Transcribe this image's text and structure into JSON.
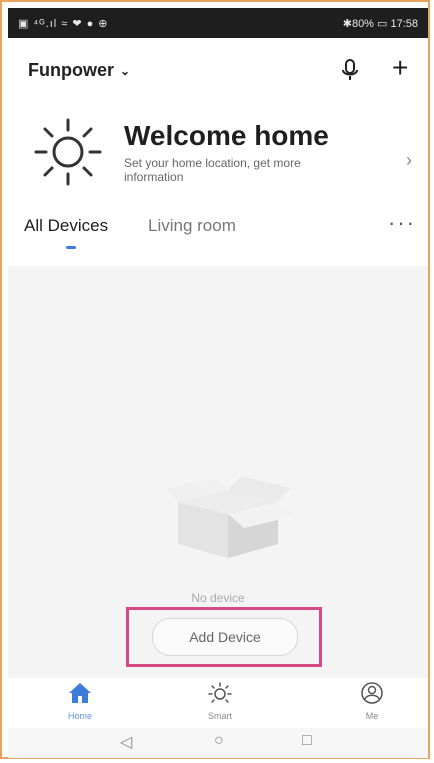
{
  "status_bar": {
    "left": "▣ ⁴ᴳ.ıl ≈ ❤ ● ⊕",
    "right": "✱80% ▭ 17:58"
  },
  "header": {
    "home_name": "Funpower",
    "home_chevron": "⌄",
    "mic_icon": "microphone-icon",
    "add_symbol": "+"
  },
  "welcome": {
    "title": "Welcome home",
    "subtitle": "Set your home location, get more information",
    "arrow": "›"
  },
  "tabs": {
    "items": [
      {
        "label": "All Devices",
        "active": true
      },
      {
        "label": "Living room",
        "active": false
      }
    ],
    "more": "···"
  },
  "empty_state": {
    "message": "No device",
    "add_button": "Add Device"
  },
  "tabbar": {
    "items": [
      {
        "label": "Home",
        "icon": "home-icon",
        "active": true
      },
      {
        "label": "Smart",
        "icon": "sun-icon",
        "active": false
      },
      {
        "label": "Me",
        "icon": "user-icon",
        "active": false
      }
    ]
  },
  "navbar": {
    "back": "◁",
    "home": "○",
    "recent": "□"
  },
  "colors": {
    "accent": "#3b7dd8",
    "highlight": "#d84a87",
    "frame": "#e8a35e"
  }
}
